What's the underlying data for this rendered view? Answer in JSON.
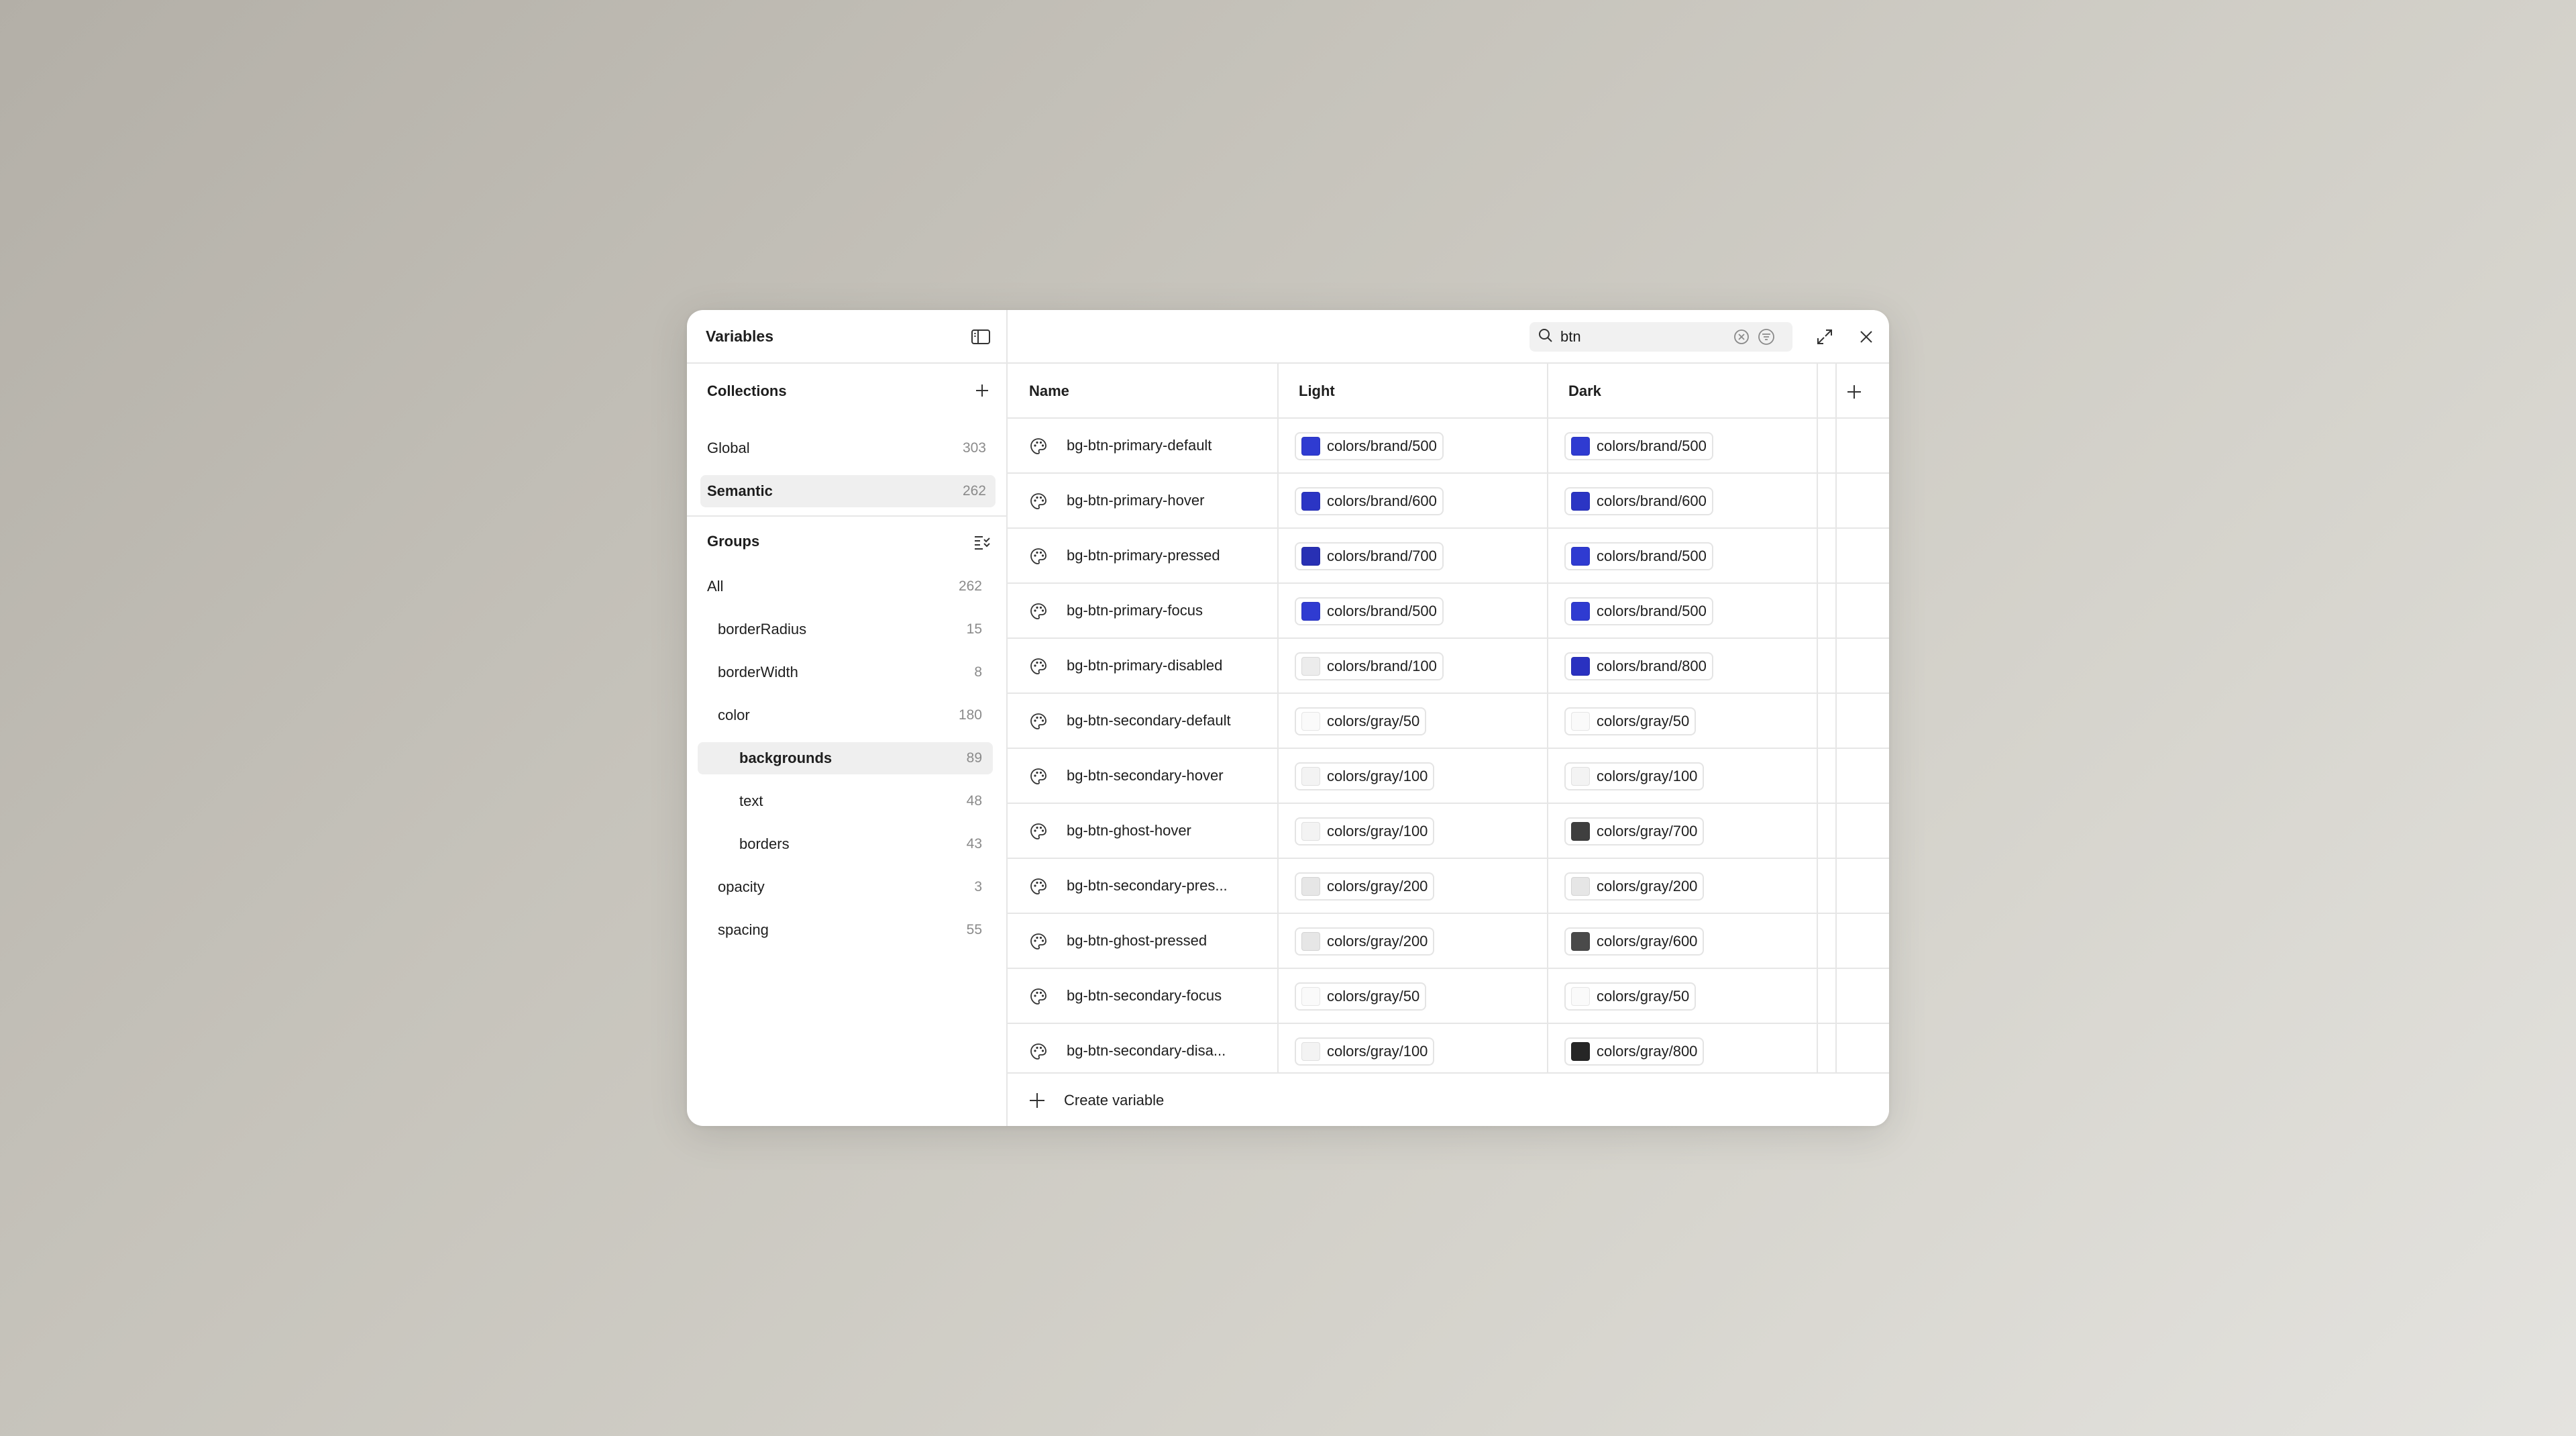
{
  "colors": {
    "brand": "#2f3bd1",
    "accent": "#1e1e1e"
  },
  "sidebar": {
    "title": "Variables",
    "collections": {
      "title": "Collections",
      "items": [
        {
          "label": "Global",
          "count": "303",
          "selected": false
        },
        {
          "label": "Semantic",
          "count": "262",
          "selected": true
        }
      ]
    },
    "groups": {
      "title": "Groups",
      "items": [
        {
          "label": "All",
          "count": "262",
          "level": 0,
          "selected": false
        },
        {
          "label": "borderRadius",
          "count": "15",
          "level": 1,
          "selected": false
        },
        {
          "label": "borderWidth",
          "count": "8",
          "level": 1,
          "selected": false
        },
        {
          "label": "color",
          "count": "180",
          "level": 1,
          "selected": false
        },
        {
          "label": "backgrounds",
          "count": "89",
          "level": 2,
          "selected": true
        },
        {
          "label": "text",
          "count": "48",
          "level": 2,
          "selected": false
        },
        {
          "label": "borders",
          "count": "43",
          "level": 2,
          "selected": false
        },
        {
          "label": "opacity",
          "count": "3",
          "level": 1,
          "selected": false
        },
        {
          "label": "spacing",
          "count": "55",
          "level": 1,
          "selected": false
        }
      ]
    }
  },
  "search": {
    "value": "btn",
    "placeholder": "Search"
  },
  "table": {
    "columns": [
      "Name",
      "Light",
      "Dark"
    ],
    "rows": [
      {
        "name": "bg-btn-primary-default",
        "light": "colors/brand/500",
        "light_color": "#2f3bd1",
        "dark": "colors/brand/500",
        "dark_color": "#2f3bd1"
      },
      {
        "name": "bg-btn-primary-hover",
        "light": "colors/brand/600",
        "light_color": "#2b35c4",
        "dark": "colors/brand/600",
        "dark_color": "#2b35c4"
      },
      {
        "name": "bg-btn-primary-pressed",
        "light": "colors/brand/700",
        "light_color": "#2830b4",
        "dark": "colors/brand/500",
        "dark_color": "#2f3bd1"
      },
      {
        "name": "bg-btn-primary-focus",
        "light": "colors/brand/500",
        "light_color": "#2f3bd1",
        "dark": "colors/brand/500",
        "dark_color": "#2f3bd1"
      },
      {
        "name": "bg-btn-primary-disabled",
        "light": "colors/brand/100",
        "light_color": "#ececec",
        "dark": "colors/brand/800",
        "dark_color": "#2a31c0"
      },
      {
        "name": "bg-btn-secondary-default",
        "light": "colors/gray/50",
        "light_color": "#fafafa",
        "dark": "colors/gray/50",
        "dark_color": "#fafafa"
      },
      {
        "name": "bg-btn-secondary-hover",
        "light": "colors/gray/100",
        "light_color": "#f3f3f3",
        "dark": "colors/gray/100",
        "dark_color": "#f3f3f3"
      },
      {
        "name": "bg-btn-ghost-hover",
        "light": "colors/gray/100",
        "light_color": "#f3f3f3",
        "dark": "colors/gray/700",
        "dark_color": "#3f3f3f"
      },
      {
        "name": "bg-btn-secondary-pres...",
        "light": "colors/gray/200",
        "light_color": "#e6e6e6",
        "dark": "colors/gray/200",
        "dark_color": "#e6e6e6"
      },
      {
        "name": "bg-btn-ghost-pressed",
        "light": "colors/gray/200",
        "light_color": "#e6e6e6",
        "dark": "colors/gray/600",
        "dark_color": "#4a4a4a"
      },
      {
        "name": "bg-btn-secondary-focus",
        "light": "colors/gray/50",
        "light_color": "#fafafa",
        "dark": "colors/gray/50",
        "dark_color": "#fafafa"
      },
      {
        "name": "bg-btn-secondary-disa...",
        "light": "colors/gray/100",
        "light_color": "#f3f3f3",
        "dark": "colors/gray/800",
        "dark_color": "#262626"
      }
    ]
  },
  "footer": {
    "create_label": "Create variable"
  },
  "icons": {
    "sidebar_toggle": "sidebar-toggle-icon",
    "add": "plus-icon",
    "group_options": "list-options-icon",
    "search": "search-icon",
    "clear": "clear-circle-icon",
    "filter": "filter-icon",
    "expand": "expand-icon",
    "close": "close-icon",
    "variable": "palette-icon"
  }
}
